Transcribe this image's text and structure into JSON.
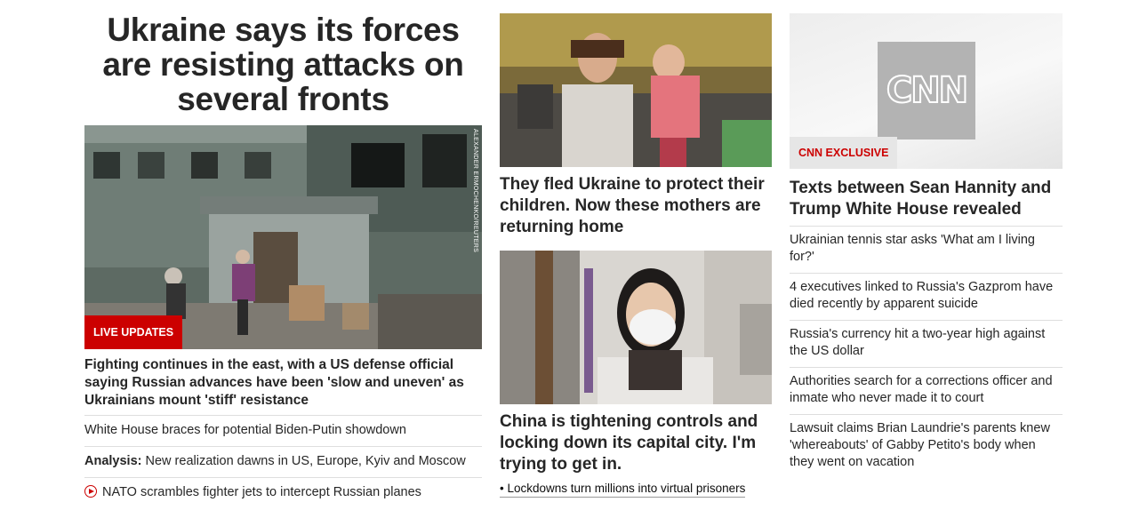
{
  "col1": {
    "headline": "Ukraine says its forces are resisting attacks on several fronts",
    "image_credit": "ALEXANDER ERMOCHENKO/REUTERS",
    "badge": "LIVE UPDATES",
    "story_title": "Fighting continues in the east, with a US defense official saying Russian advances have been 'slow and uneven' as Ukrainians mount 'stiff' resistance",
    "links": {
      "item1": "White House braces for potential Biden-Putin showdown",
      "item2_prefix": "Analysis:",
      "item2_text": " New realization dawns in US, Europe, Kyiv and Moscow",
      "item3": "NATO scrambles fighter jets to intercept Russian planes"
    }
  },
  "col2": {
    "story1_title": "They fled Ukraine to protect their children. Now these mothers are returning home",
    "story2_title": "China is tightening controls and locking down its capital city. I'm trying to get in.",
    "story2_link": "• Lockdowns turn millions into virtual prisoners"
  },
  "col3": {
    "logo_text": "CNN",
    "badge": "CNN EXCLUSIVE",
    "story_title": "Texts between Sean Hannity and Trump White House revealed",
    "list": [
      "Ukrainian tennis star asks 'What am I living for?'",
      "4 executives linked to Russia's Gazprom have died recently by apparent suicide",
      "Russia's currency hit a two-year high against the US dollar",
      "Authorities search for a corrections officer and inmate who never made it to court",
      "Lawsuit claims Brian Laundrie's parents knew 'whereabouts' of Gabby Petito's body when they went on vacation"
    ]
  },
  "colors": {
    "accent": "#cc0000",
    "text": "#262626",
    "divider": "#dedede"
  }
}
